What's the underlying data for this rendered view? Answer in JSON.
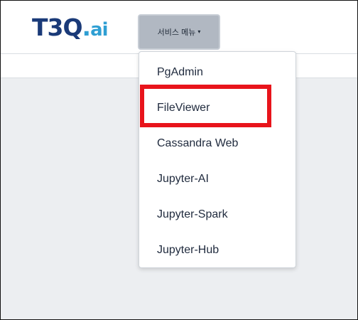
{
  "logo": {
    "main": "T3Q",
    "dot": ".",
    "tld": "ai"
  },
  "menu_button": {
    "label": "서비스 메뉴",
    "caret": "▾"
  },
  "dropdown": {
    "items": [
      {
        "label": "PgAdmin"
      },
      {
        "label": "FileViewer"
      },
      {
        "label": "Cassandra Web"
      },
      {
        "label": "Jupyter-AI"
      },
      {
        "label": "Jupyter-Spark"
      },
      {
        "label": "Jupyter-Hub"
      }
    ],
    "highlighted_item": "FileViewer",
    "highlight_color": "#e8141b"
  },
  "colors": {
    "logo_main": "#1a3a78",
    "logo_accent": "#2f9fd3",
    "menu_button_bg": "#b1b8c2"
  }
}
